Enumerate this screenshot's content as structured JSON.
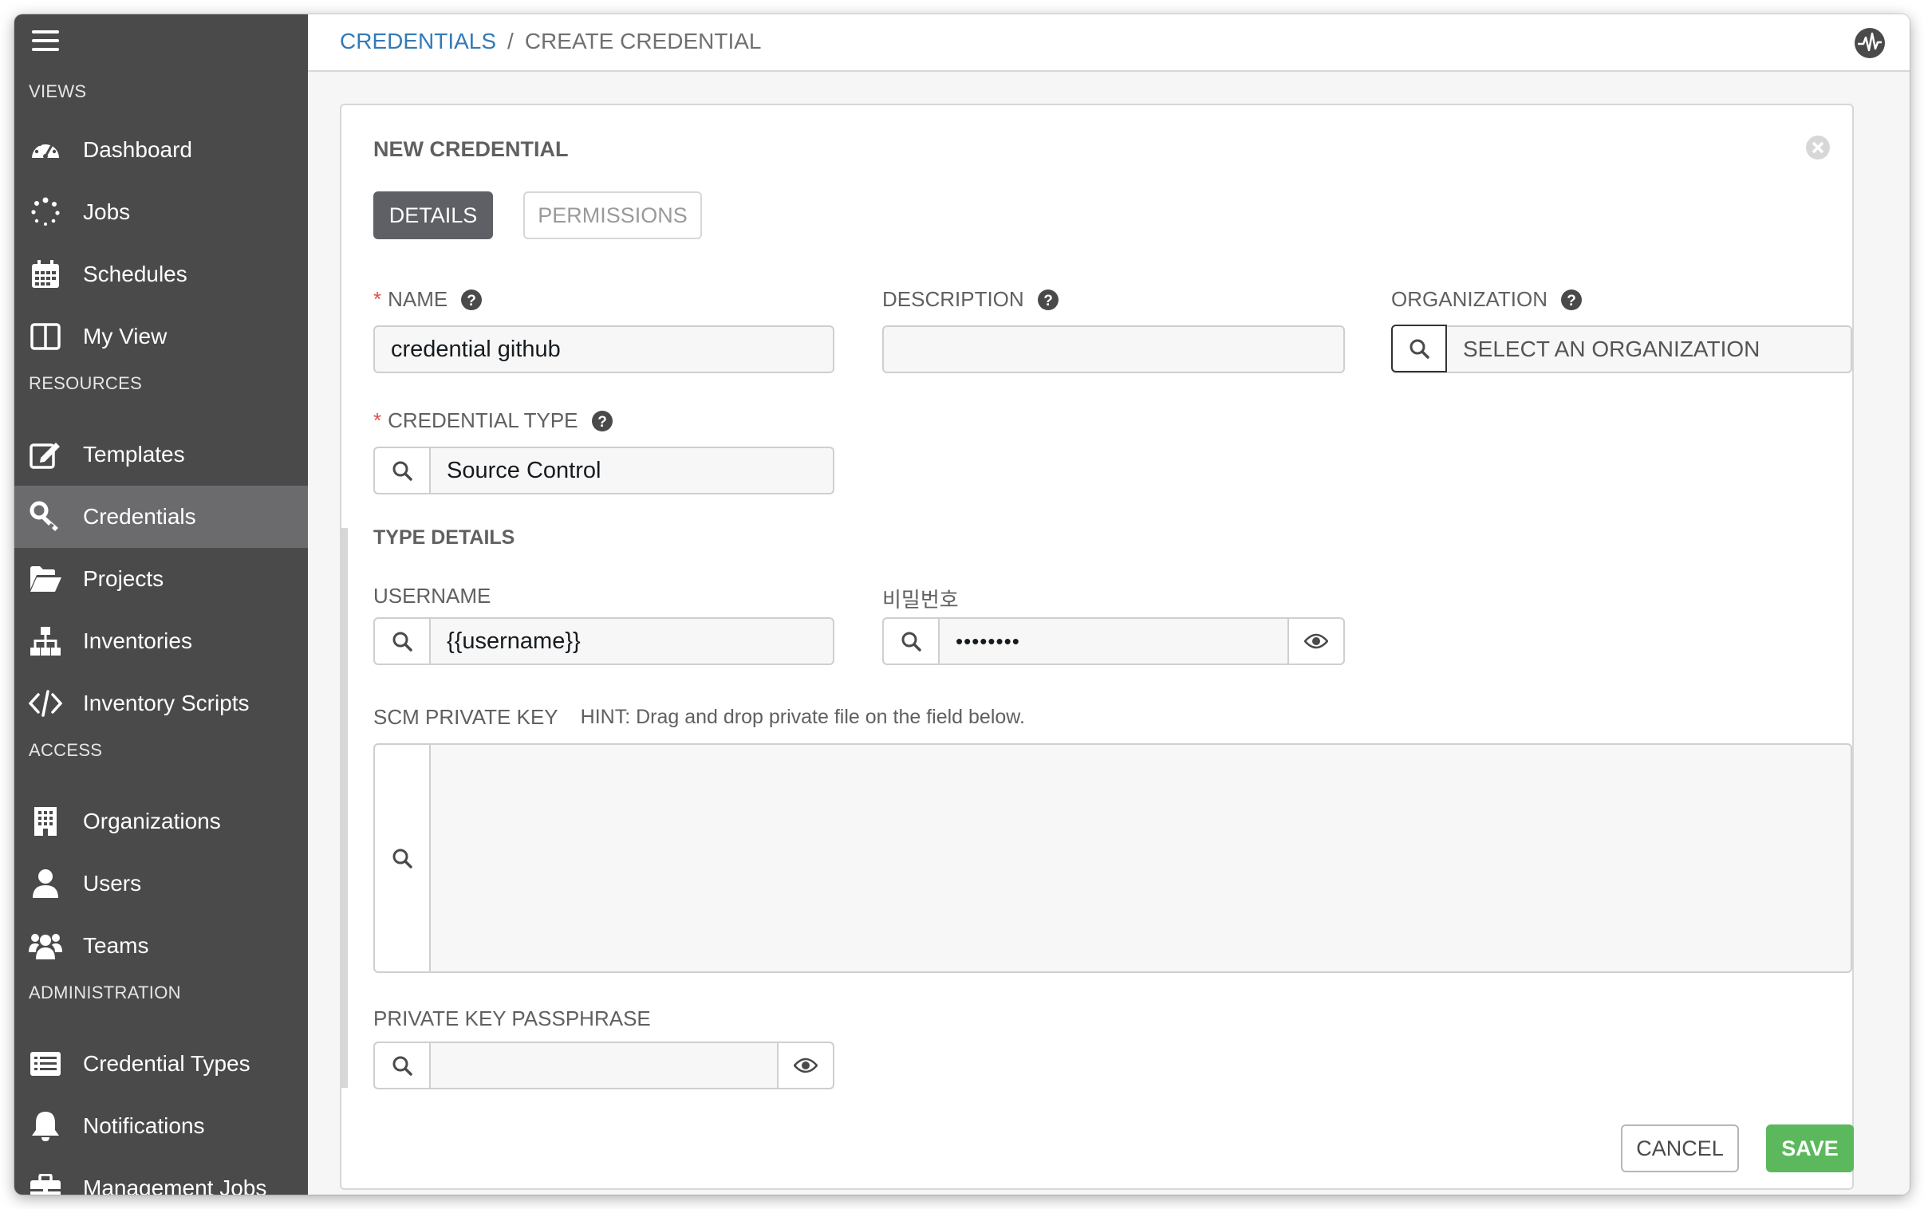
{
  "sidebar": {
    "sections": {
      "views": "VIEWS",
      "resources": "RESOURCES",
      "access": "ACCESS",
      "administration": "ADMINISTRATION"
    },
    "items": [
      {
        "label": "Dashboard",
        "icon": "dashboard-icon"
      },
      {
        "label": "Jobs",
        "icon": "jobs-icon"
      },
      {
        "label": "Schedules",
        "icon": "calendar-icon"
      },
      {
        "label": "My View",
        "icon": "columns-icon"
      },
      {
        "label": "Templates",
        "icon": "edit-icon"
      },
      {
        "label": "Credentials",
        "icon": "key-icon",
        "active": true
      },
      {
        "label": "Projects",
        "icon": "folder-open-icon"
      },
      {
        "label": "Inventories",
        "icon": "sitemap-icon"
      },
      {
        "label": "Inventory Scripts",
        "icon": "code-icon"
      },
      {
        "label": "Organizations",
        "icon": "building-icon"
      },
      {
        "label": "Users",
        "icon": "user-icon"
      },
      {
        "label": "Teams",
        "icon": "users-icon"
      },
      {
        "label": "Credential Types",
        "icon": "list-alt-icon"
      },
      {
        "label": "Notifications",
        "icon": "bell-icon"
      },
      {
        "label": "Management Jobs",
        "icon": "briefcase-icon"
      }
    ]
  },
  "breadcrumb": {
    "parent": "CREDENTIALS",
    "separator": "/",
    "current": "CREATE CREDENTIAL"
  },
  "form": {
    "title": "NEW CREDENTIAL",
    "tabs": {
      "details": "DETAILS",
      "permissions": "PERMISSIONS"
    },
    "name": {
      "label": "NAME",
      "value": "credential github"
    },
    "description": {
      "label": "DESCRIPTION",
      "value": ""
    },
    "organization": {
      "label": "ORGANIZATION",
      "placeholder": "SELECT AN ORGANIZATION"
    },
    "credential_type": {
      "label": "CREDENTIAL TYPE",
      "value": "Source Control"
    },
    "type_details": "TYPE DETAILS",
    "username": {
      "label": "USERNAME",
      "value": "{{username}}"
    },
    "password": {
      "label": "비밀번호",
      "value": "••••••••"
    },
    "scm_key": {
      "label": "SCM PRIVATE KEY",
      "hint": "HINT: Drag and drop private file on the field below."
    },
    "passphrase": {
      "label": "PRIVATE KEY PASSPHRASE",
      "value": ""
    },
    "required_marker": "*",
    "cancel": "CANCEL",
    "save": "SAVE"
  },
  "colors": {
    "sidebar_bg": "#4a4a4b",
    "sidebar_active": "#6b6b6d",
    "link": "#337ab7",
    "save": "#5cb85c",
    "required": "#d9534f"
  }
}
